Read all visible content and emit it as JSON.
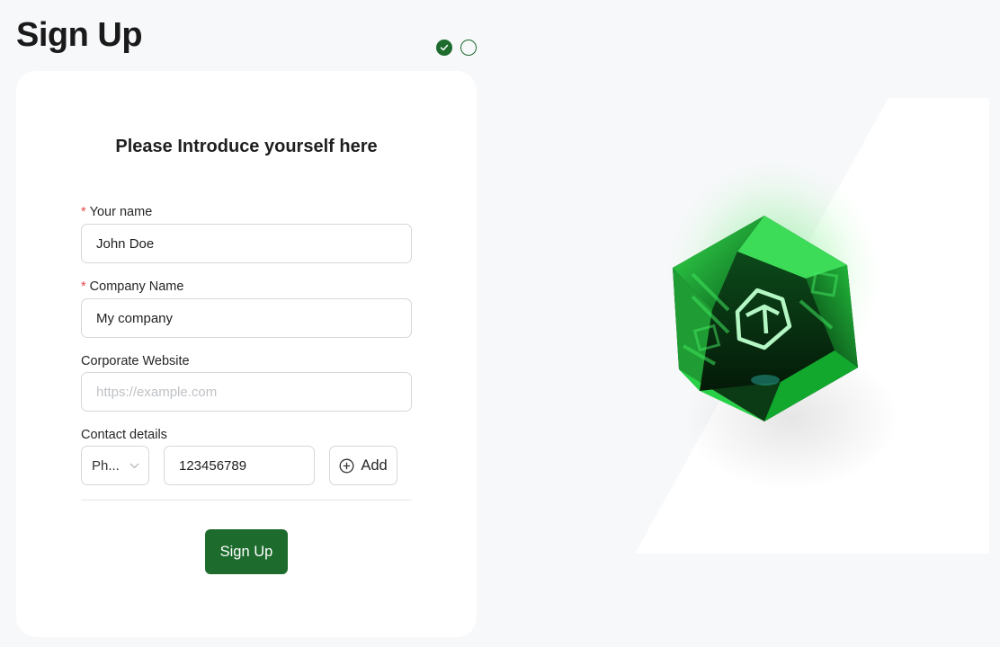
{
  "page": {
    "title": "Sign Up"
  },
  "steps": [
    {
      "state": "completed",
      "icon": "check-icon"
    },
    {
      "state": "pending",
      "icon": "circle-outline-icon"
    }
  ],
  "form": {
    "heading": "Please Introduce yourself here",
    "name": {
      "label": "Your name",
      "required": true,
      "value": "John Doe"
    },
    "company": {
      "label": "Company Name",
      "required": true,
      "value": "My company"
    },
    "website": {
      "label": "Corporate Website",
      "required": false,
      "value": "",
      "placeholder": "https://example.com"
    },
    "contact": {
      "label": "Contact details",
      "type_value": "Ph...",
      "number_value": "123456789",
      "add_label": "Add",
      "add_icon": "plus-circle-icon",
      "select_icon": "chevron-down-icon"
    },
    "submit_label": "Sign Up"
  },
  "colors": {
    "primary": "#1e6b2e",
    "required_star": "#e5484d",
    "page_background": "#f7f8fa",
    "card_background": "#ffffff",
    "border": "#d5d7da",
    "gem_green": "#1fb53a"
  },
  "illustration": {
    "name": "green-gem-logo-illustration"
  }
}
